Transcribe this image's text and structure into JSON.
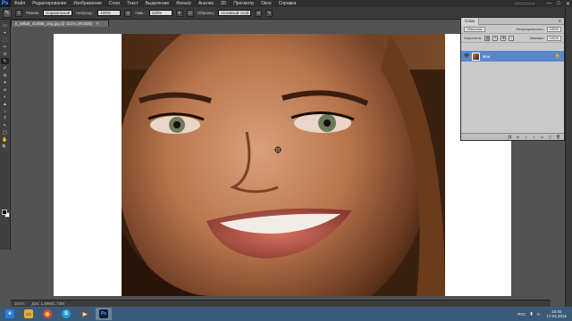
{
  "app": {
    "logo": "Ps"
  },
  "menu": [
    "Файл",
    "Редактирование",
    "Изображение",
    "Слои",
    "Текст",
    "Выделение",
    "Фильтр",
    "Анализ",
    "3D",
    "Просмотр",
    "Окно",
    "Справка"
  ],
  "window_controls": {
    "minimize": "—",
    "maximize": "□",
    "close": "✕",
    "workspace": ""
  },
  "options": {
    "brush_size": "3",
    "mode_label": "Режим:",
    "mode_value": "Нормальный",
    "opacity_label": "Непрозр.:",
    "opacity_value": "100%",
    "flow_label": "Наж.:",
    "flow_value": "100%",
    "sample_label": "Образец:",
    "sample_value": "Активный слой"
  },
  "document": {
    "tab_title": "8_59fa9_nb4f98_orig.jpg @ 101% (RGB/8)",
    "close": "✕"
  },
  "status": {
    "zoom": "101%",
    "doc_info": "Док: 1,69М/1,73М"
  },
  "tools": [
    "▭",
    "⌖",
    "⬚",
    "✂",
    "⊙",
    "✎",
    "✐",
    "⊚",
    "✦",
    "⌀",
    "◐",
    "▲",
    "⬦",
    "T",
    "↖",
    "▢",
    "✋",
    "🔍"
  ],
  "layers_panel": {
    "tab_label": "Слои",
    "menu_icon": "≡",
    "blend_mode": "Обычные",
    "opacity_label": "Непрозрачность:",
    "opacity_value": "100%",
    "lock_label": "Закрепить:",
    "fill_label": "Заливка:",
    "fill_value": "100%",
    "layer_name": "Фон",
    "lock_icon": "🔒",
    "bottom_icons": [
      "⛓",
      "fx",
      "◑",
      "◐",
      "▭",
      "▢",
      "🗑"
    ]
  },
  "taskbar": {
    "apps": [
      {
        "name": "ie",
        "glyph": "e",
        "color": "#2a7de1"
      },
      {
        "name": "explorer",
        "glyph": "▭",
        "color": "#e0b040"
      },
      {
        "name": "chrome",
        "glyph": "◉",
        "color": "#e04a3a"
      },
      {
        "name": "skype",
        "glyph": "S",
        "color": "#1ea0e0"
      },
      {
        "name": "media",
        "glyph": "▶",
        "color": "#555"
      },
      {
        "name": "photoshop",
        "glyph": "Ps",
        "color": "#0b1d33"
      }
    ],
    "tray": {
      "lang": "РУС",
      "time": "16:50",
      "date": "17.04.2015"
    }
  },
  "colors": {
    "menubar": "#2f2f2f",
    "panel": "#c9c9c9",
    "selected_layer": "#5a87c9",
    "taskbar": "#3b5a7a"
  }
}
